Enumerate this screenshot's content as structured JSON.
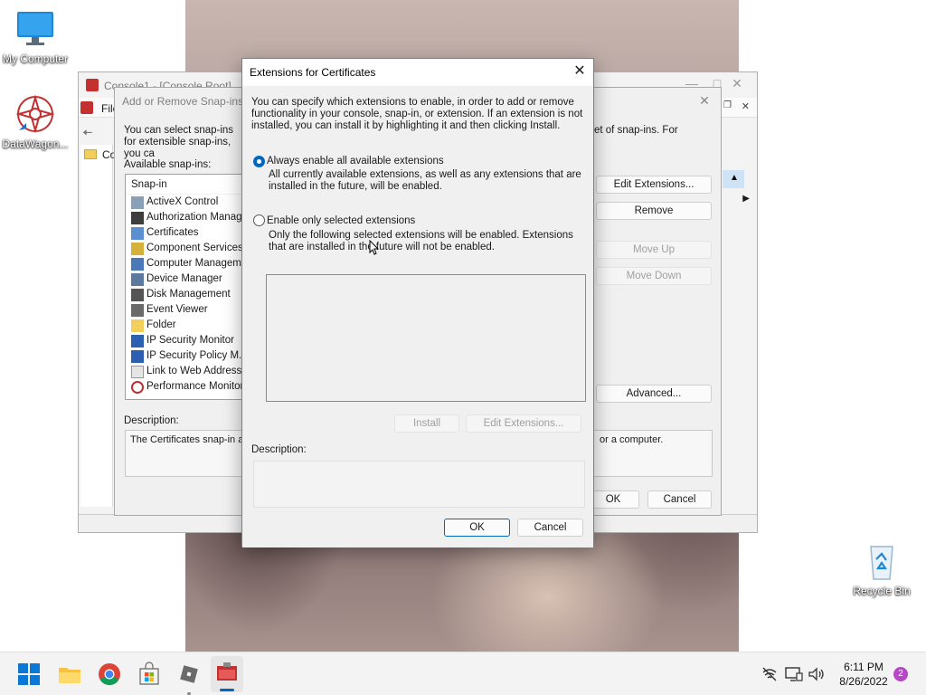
{
  "desktop": {
    "icons": [
      {
        "label": "My Computer",
        "icon": "monitor-icon"
      },
      {
        "label": "DataWagon...",
        "icon": "datawagon-app-icon"
      },
      {
        "label": "Recycle Bin",
        "icon": "recycle-bin-icon"
      }
    ]
  },
  "mmc": {
    "title": "Console1 - [Console Root]",
    "menu_first": "File",
    "tree_item": "Co"
  },
  "snapins_dialog": {
    "title": "Add or Remove Snap-ins",
    "intro_left": "You can select snap-ins for extensible snap-ins, you ca",
    "intro_right": "et of snap-ins. For",
    "available_label": "Available snap-ins:",
    "list_header": "Snap-in",
    "items": [
      "ActiveX Control",
      "Authorization Manager",
      "Certificates",
      "Component Services",
      "Computer Managem...",
      "Device Manager",
      "Disk Management",
      "Event Viewer",
      "Folder",
      "IP Security Monitor",
      "IP Security Policy M...",
      "Link to Web Address",
      "Performance Monitor"
    ],
    "edit_extensions_button": "Edit Extensions...",
    "remove_button": "Remove",
    "move_up_button": "Move Up",
    "move_down_button": "Move Down",
    "advanced_button": "Advanced...",
    "description_label": "Description:",
    "description_text_left": "The Certificates snap-in al",
    "description_text_right": "or a computer.",
    "ok_button": "OK",
    "cancel_button": "Cancel"
  },
  "extensions_dialog": {
    "title": "Extensions for Certificates",
    "intro": "You can specify which extensions to enable, in order to add or remove functionality in your console, snap-in, or extension. If an extension is not installed, you can install it by highlighting it and then clicking Install.",
    "option_all_label": "Always enable all available extensions",
    "option_all_desc": "All currently available extensions, as well as any extensions that are installed in the future, will be enabled.",
    "option_selected_label": "Enable only selected extensions",
    "option_selected_desc": "Only the following selected extensions will be enabled. Extensions that are installed in the future will not be enabled.",
    "selected_option": "all",
    "install_button": "Install",
    "edit_extensions_button": "Edit Extensions...",
    "description_label": "Description:",
    "ok_button": "OK",
    "cancel_button": "Cancel"
  },
  "taskbar": {
    "apps": [
      "windows-start-icon",
      "file-explorer-icon",
      "chrome-icon",
      "microsoft-store-icon",
      "roblox-icon",
      "mmc-console-icon"
    ],
    "time": "6:11 PM",
    "date": "8/26/2022",
    "notification_count": "2"
  },
  "colors": {
    "accent": "#0067c0",
    "taskbar_bg": "#f3f3f3",
    "dialog_bg": "#f0f0f0"
  }
}
